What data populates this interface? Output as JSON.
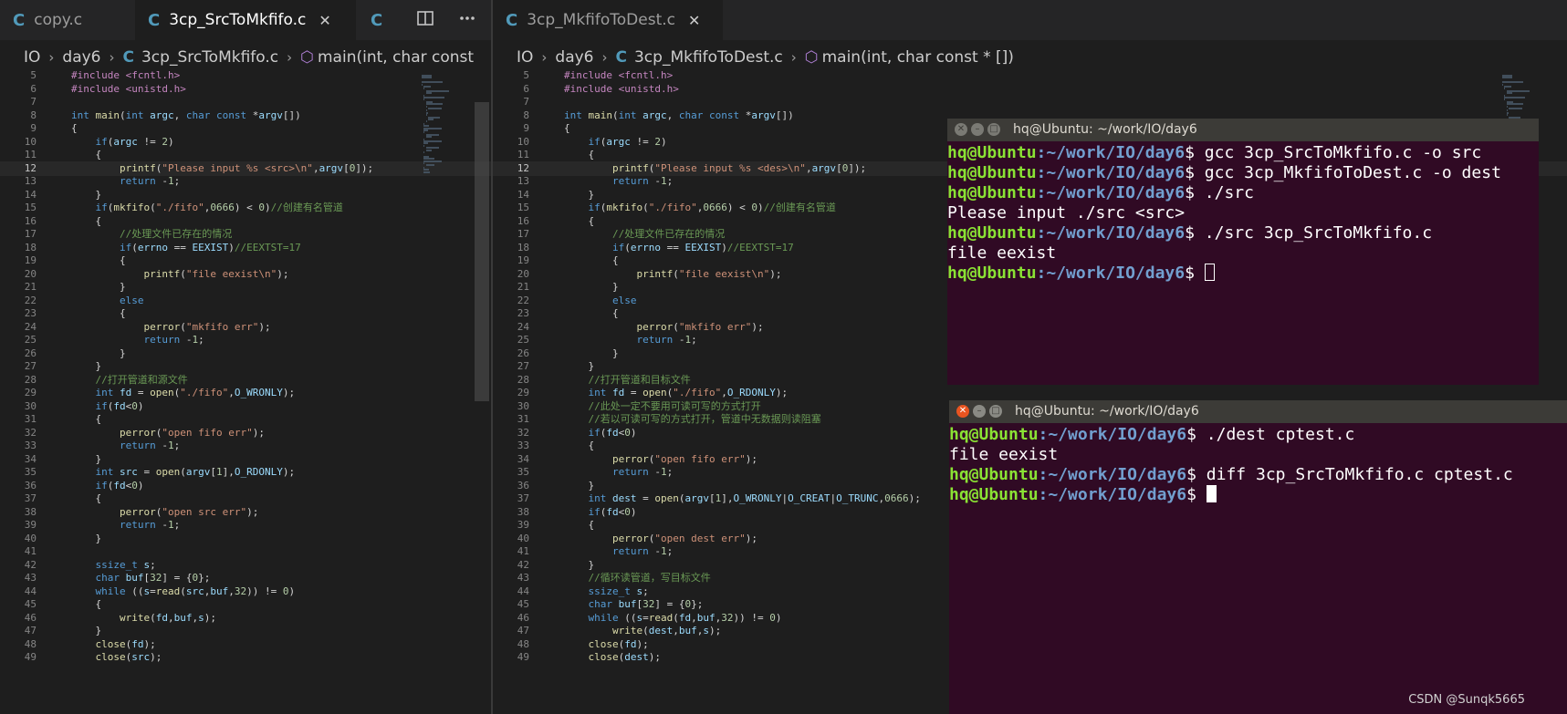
{
  "left_editor": {
    "tabs": [
      {
        "icon": "C",
        "label": "copy.c",
        "active": false,
        "close": ""
      },
      {
        "icon": "C",
        "label": "3cp_SrcToMkfifo.c",
        "active": true,
        "close": "✕"
      },
      {
        "icon": "C",
        "label": "",
        "active": false,
        "close": ""
      }
    ],
    "actions": [
      "split-editor-icon",
      "more-actions-icon"
    ],
    "breadcrumb": {
      "folder": "IO",
      "subfolder": "day6",
      "file": "3cp_SrcToMkfifo.c",
      "symbol": "main(int, char const"
    },
    "current_line": 12,
    "lines": [
      {
        "n": 5,
        "t": "#include <fcntl.h>"
      },
      {
        "n": 6,
        "t": "#include <unistd.h>"
      },
      {
        "n": 7,
        "t": ""
      },
      {
        "n": 8,
        "t": "int main(int argc, char const *argv[])"
      },
      {
        "n": 9,
        "t": "{"
      },
      {
        "n": 10,
        "t": "    if(argc != 2)"
      },
      {
        "n": 11,
        "t": "    {"
      },
      {
        "n": 12,
        "t": "        printf(\"Please input %s <src>\\n\",argv[0]);"
      },
      {
        "n": 13,
        "t": "        return -1;"
      },
      {
        "n": 14,
        "t": "    }"
      },
      {
        "n": 15,
        "t": "    if(mkfifo(\"./fifo\",0666) < 0)//创建有名管道"
      },
      {
        "n": 16,
        "t": "    {"
      },
      {
        "n": 17,
        "t": "        //处理文件已存在的情况"
      },
      {
        "n": 18,
        "t": "        if(errno == EEXIST)//EEXTST=17"
      },
      {
        "n": 19,
        "t": "        {"
      },
      {
        "n": 20,
        "t": "            printf(\"file eexist\\n\");"
      },
      {
        "n": 21,
        "t": "        }"
      },
      {
        "n": 22,
        "t": "        else"
      },
      {
        "n": 23,
        "t": "        {"
      },
      {
        "n": 24,
        "t": "            perror(\"mkfifo err\");"
      },
      {
        "n": 25,
        "t": "            return -1;"
      },
      {
        "n": 26,
        "t": "        }"
      },
      {
        "n": 27,
        "t": "    }"
      },
      {
        "n": 28,
        "t": "    //打开管道和源文件"
      },
      {
        "n": 29,
        "t": "    int fd = open(\"./fifo\",O_WRONLY);"
      },
      {
        "n": 30,
        "t": "    if(fd<0)"
      },
      {
        "n": 31,
        "t": "    {"
      },
      {
        "n": 32,
        "t": "        perror(\"open fifo err\");"
      },
      {
        "n": 33,
        "t": "        return -1;"
      },
      {
        "n": 34,
        "t": "    }"
      },
      {
        "n": 35,
        "t": "    int src = open(argv[1],O_RDONLY);"
      },
      {
        "n": 36,
        "t": "    if(fd<0)"
      },
      {
        "n": 37,
        "t": "    {"
      },
      {
        "n": 38,
        "t": "        perror(\"open src err\");"
      },
      {
        "n": 39,
        "t": "        return -1;"
      },
      {
        "n": 40,
        "t": "    }"
      },
      {
        "n": 41,
        "t": ""
      },
      {
        "n": 42,
        "t": "    ssize_t s;"
      },
      {
        "n": 43,
        "t": "    char buf[32] = {0};"
      },
      {
        "n": 44,
        "t": "    while ((s=read(src,buf,32)) != 0)"
      },
      {
        "n": 45,
        "t": "    {"
      },
      {
        "n": 46,
        "t": "        write(fd,buf,s);"
      },
      {
        "n": 47,
        "t": "    }"
      },
      {
        "n": 48,
        "t": "    close(fd);"
      },
      {
        "n": 49,
        "t": "    close(src);"
      }
    ]
  },
  "right_editor": {
    "tabs": [
      {
        "icon": "C",
        "label": "3cp_MkfifoToDest.c",
        "active": false,
        "close": "✕"
      }
    ],
    "breadcrumb": {
      "folder": "IO",
      "subfolder": "day6",
      "file": "3cp_MkfifoToDest.c",
      "symbol": "main(int, char const * [])"
    },
    "current_line": 12,
    "lines": [
      {
        "n": 5,
        "t": "#include <fcntl.h>"
      },
      {
        "n": 6,
        "t": "#include <unistd.h>"
      },
      {
        "n": 7,
        "t": ""
      },
      {
        "n": 8,
        "t": "int main(int argc, char const *argv[])"
      },
      {
        "n": 9,
        "t": "{"
      },
      {
        "n": 10,
        "t": "    if(argc != 2)"
      },
      {
        "n": 11,
        "t": "    {"
      },
      {
        "n": 12,
        "t": "        printf(\"Please input %s <des>\\n\",argv[0]);"
      },
      {
        "n": 13,
        "t": "        return -1;"
      },
      {
        "n": 14,
        "t": "    }"
      },
      {
        "n": 15,
        "t": "    if(mkfifo(\"./fifo\",0666) < 0)//创建有名管道"
      },
      {
        "n": 16,
        "t": "    {"
      },
      {
        "n": 17,
        "t": "        //处理文件已存在的情况"
      },
      {
        "n": 18,
        "t": "        if(errno == EEXIST)//EEXTST=17"
      },
      {
        "n": 19,
        "t": "        {"
      },
      {
        "n": 20,
        "t": "            printf(\"file eexist\\n\");"
      },
      {
        "n": 21,
        "t": "        }"
      },
      {
        "n": 22,
        "t": "        else"
      },
      {
        "n": 23,
        "t": "        {"
      },
      {
        "n": 24,
        "t": "            perror(\"mkfifo err\");"
      },
      {
        "n": 25,
        "t": "            return -1;"
      },
      {
        "n": 26,
        "t": "        }"
      },
      {
        "n": 27,
        "t": "    }"
      },
      {
        "n": 28,
        "t": "    //打开管道和目标文件"
      },
      {
        "n": 29,
        "t": "    int fd = open(\"./fifo\",O_RDONLY);"
      },
      {
        "n": 30,
        "t": "    //此处一定不要用可读可写的方式打开"
      },
      {
        "n": 31,
        "t": "    //若以可读可写的方式打开，管道中无数据则读阻塞"
      },
      {
        "n": 32,
        "t": "    if(fd<0)"
      },
      {
        "n": 33,
        "t": "    {"
      },
      {
        "n": 34,
        "t": "        perror(\"open fifo err\");"
      },
      {
        "n": 35,
        "t": "        return -1;"
      },
      {
        "n": 36,
        "t": "    }"
      },
      {
        "n": 37,
        "t": "    int dest = open(argv[1],O_WRONLY|O_CREAT|O_TRUNC,0666);"
      },
      {
        "n": 38,
        "t": "    if(fd<0)"
      },
      {
        "n": 39,
        "t": "    {"
      },
      {
        "n": 40,
        "t": "        perror(\"open dest err\");"
      },
      {
        "n": 41,
        "t": "        return -1;"
      },
      {
        "n": 42,
        "t": "    }"
      },
      {
        "n": 43,
        "t": "    //循环读管道，写目标文件"
      },
      {
        "n": 44,
        "t": "    ssize_t s;"
      },
      {
        "n": 45,
        "t": "    char buf[32] = {0};"
      },
      {
        "n": 46,
        "t": "    while ((s=read(fd,buf,32)) != 0)"
      },
      {
        "n": 47,
        "t": "        write(dest,buf,s);"
      },
      {
        "n": 48,
        "t": "    close(fd);"
      },
      {
        "n": 49,
        "t": "    close(dest);"
      }
    ]
  },
  "terminals": [
    {
      "title": "hq@Ubuntu: ~/work/IO/day6",
      "buttons": [
        "✕",
        "–",
        "□"
      ],
      "lines": [
        {
          "user": "hq@Ubuntu",
          "path": ":~/work/IO/day6",
          "sym": "$ ",
          "cmd": "gcc 3cp_SrcToMkfifo.c -o src"
        },
        {
          "user": "hq@Ubuntu",
          "path": ":~/work/IO/day6",
          "sym": "$ ",
          "cmd": "gcc 3cp_MkfifoToDest.c -o dest"
        },
        {
          "user": "hq@Ubuntu",
          "path": ":~/work/IO/day6",
          "sym": "$ ",
          "cmd": "./src"
        },
        {
          "out": "Please input ./src <src>"
        },
        {
          "user": "hq@Ubuntu",
          "path": ":~/work/IO/day6",
          "sym": "$ ",
          "cmd": "./src 3cp_SrcToMkfifo.c"
        },
        {
          "out": "file eexist"
        },
        {
          "user": "hq@Ubuntu",
          "path": ":~/work/IO/day6",
          "sym": "$ ",
          "cmd": "",
          "cursor": "hollow"
        }
      ]
    },
    {
      "title": "hq@Ubuntu: ~/work/IO/day6",
      "buttons": [
        "✕",
        "–",
        "□"
      ],
      "lines": [
        {
          "user": "hq@Ubuntu",
          "path": ":~/work/IO/day6",
          "sym": "$ ",
          "cmd": "./dest cptest.c"
        },
        {
          "out": "file eexist"
        },
        {
          "user": "hq@Ubuntu",
          "path": ":~/work/IO/day6",
          "sym": "$ ",
          "cmd": "diff 3cp_SrcToMkfifo.c cptest.c"
        },
        {
          "user": "hq@Ubuntu",
          "path": ":~/work/IO/day6",
          "sym": "$ ",
          "cmd": "",
          "cursor": "solid"
        }
      ]
    }
  ],
  "watermark": "CSDN @Sunqk5665",
  "colors": {
    "editor_bg": "#1e1e1e",
    "terminal_bg": "#300a24",
    "prompt_user": "#8ae234",
    "prompt_path": "#729fcf",
    "keyword": "#569cd6",
    "string": "#ce9178",
    "comment": "#6a9955",
    "preprocessor": "#c586c0",
    "function": "#dcdcaa",
    "number": "#b5cea8"
  }
}
